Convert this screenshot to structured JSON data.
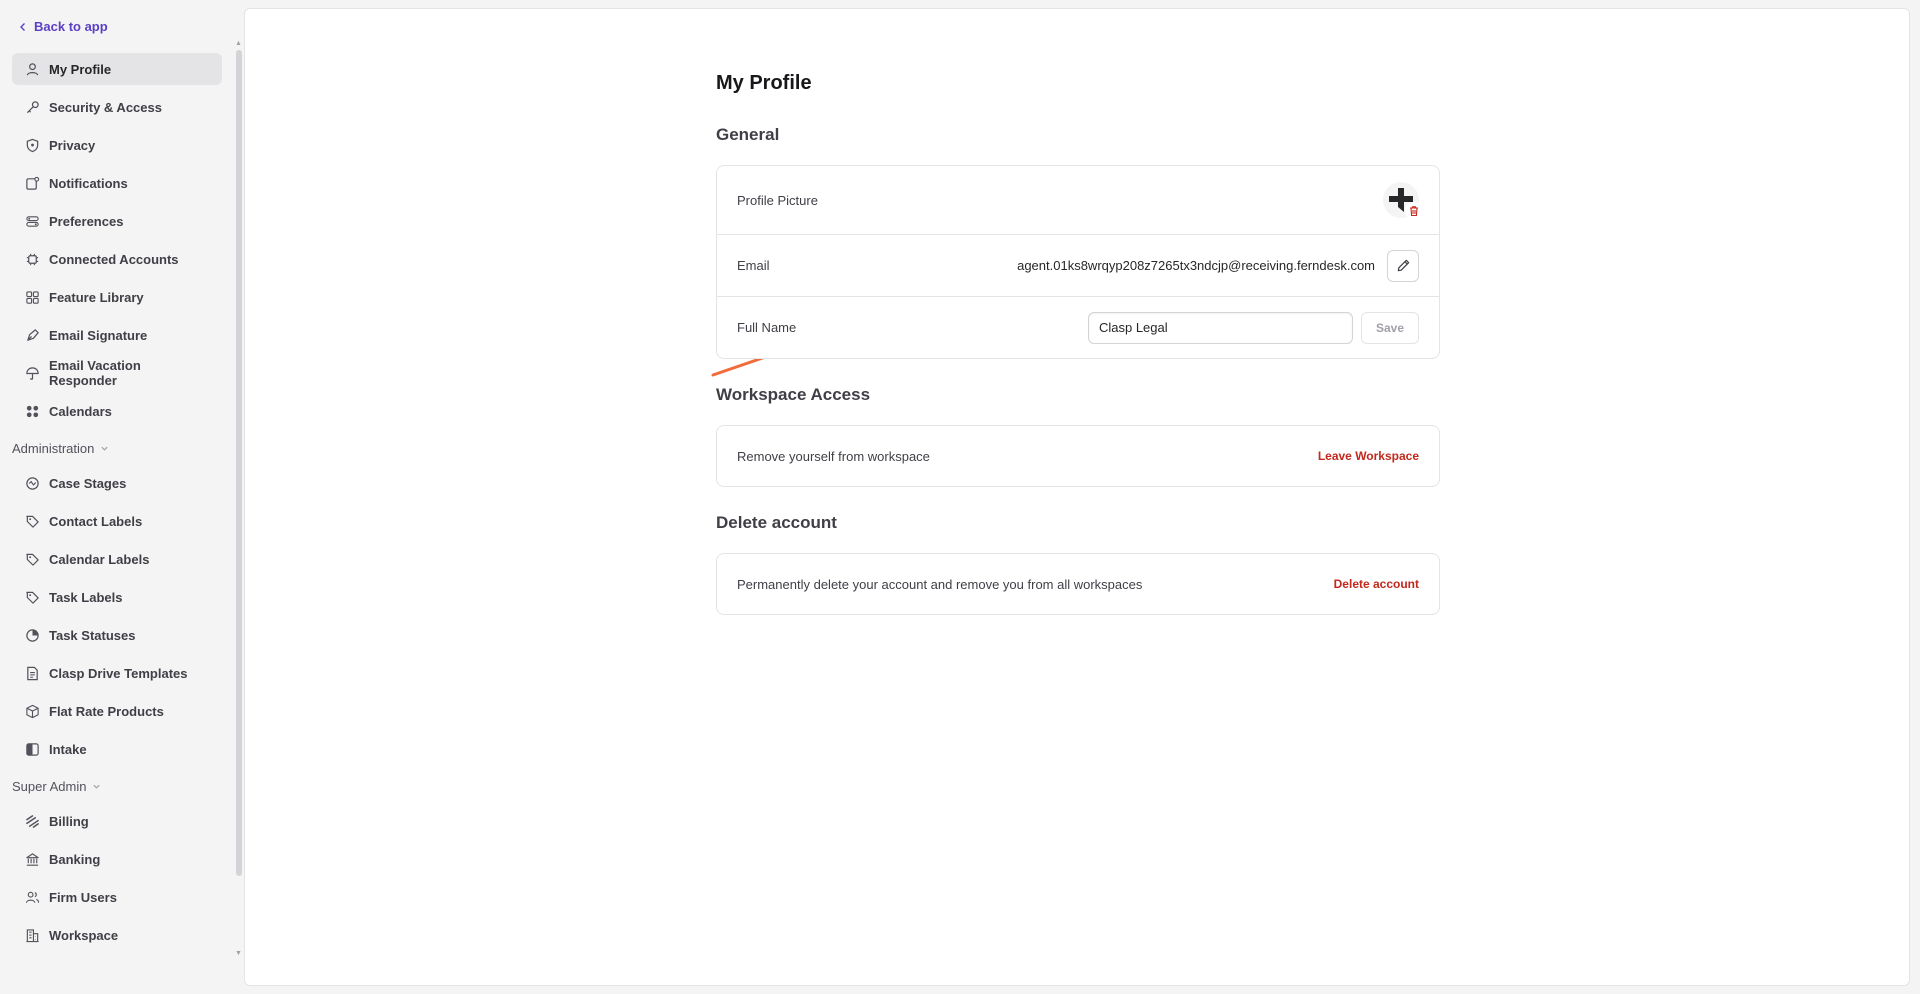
{
  "sidebar": {
    "back_label": "Back to app",
    "items": [
      {
        "label": "My Profile",
        "icon": "user-icon",
        "active": true
      },
      {
        "label": "Security & Access",
        "icon": "key-icon"
      },
      {
        "label": "Privacy",
        "icon": "shield-icon"
      },
      {
        "label": "Notifications",
        "icon": "notification-icon"
      },
      {
        "label": "Preferences",
        "icon": "toggles-icon"
      },
      {
        "label": "Connected Accounts",
        "icon": "chip-icon"
      },
      {
        "label": "Feature Library",
        "icon": "grid-icon"
      },
      {
        "label": "Email Signature",
        "icon": "pen-nib-icon"
      },
      {
        "label": "Email Vacation Responder",
        "icon": "umbrella-icon"
      },
      {
        "label": "Calendars",
        "icon": "apps-icon"
      }
    ],
    "admin_label": "Administration",
    "admin_items": [
      {
        "label": "Case Stages",
        "icon": "stages-icon"
      },
      {
        "label": "Contact Labels",
        "icon": "tag-icon"
      },
      {
        "label": "Calendar Labels",
        "icon": "tag-icon"
      },
      {
        "label": "Task Labels",
        "icon": "tag-icon"
      },
      {
        "label": "Task Statuses",
        "icon": "pie-icon"
      },
      {
        "label": "Clasp Drive Templates",
        "icon": "document-icon"
      },
      {
        "label": "Flat Rate Products",
        "icon": "box-icon"
      },
      {
        "label": "Intake",
        "icon": "intake-icon"
      }
    ],
    "super_label": "Super Admin",
    "super_items": [
      {
        "label": "Billing",
        "icon": "billing-icon"
      },
      {
        "label": "Banking",
        "icon": "bank-icon"
      },
      {
        "label": "Firm Users",
        "icon": "users-icon"
      },
      {
        "label": "Workspace",
        "icon": "building-icon"
      }
    ]
  },
  "main": {
    "title": "My Profile",
    "general_title": "General",
    "profile_picture_label": "Profile Picture",
    "email_label": "Email",
    "email_value": "agent.01ks8wrqyp208z7265tx3ndcjp@receiving.ferndesk.com",
    "full_name_label": "Full Name",
    "full_name_value": "Clasp Legal",
    "save_label": "Save",
    "workspace_title": "Workspace Access",
    "workspace_text": "Remove yourself from workspace",
    "leave_label": "Leave Workspace",
    "delete_title": "Delete account",
    "delete_text": "Permanently delete your account and remove you from all workspaces",
    "delete_label": "Delete account"
  },
  "colors": {
    "accent": "#5b3fc4",
    "danger": "#c2281c",
    "annotation_arrow": "#f26b3a"
  }
}
